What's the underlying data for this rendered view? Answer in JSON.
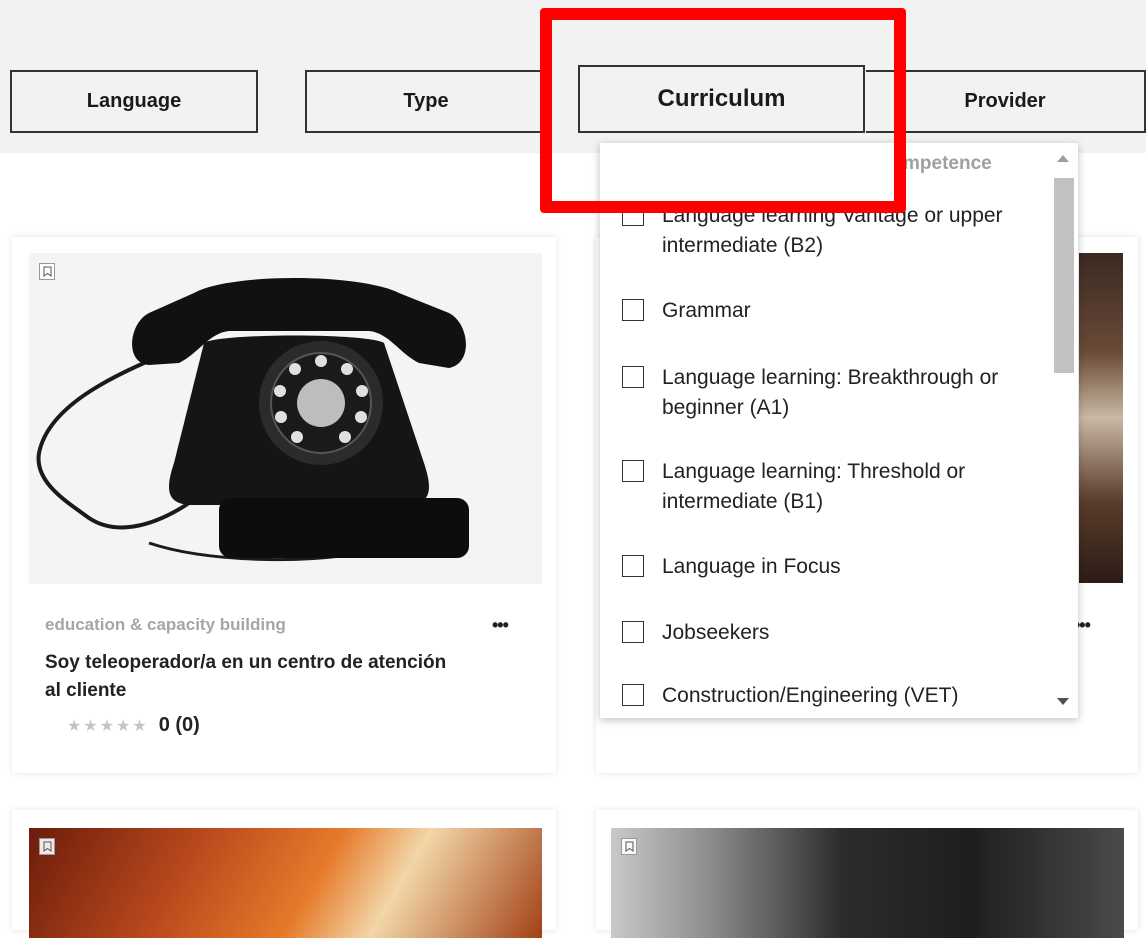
{
  "filters": {
    "language_label": "Language",
    "type_label": "Type",
    "curriculum_label": "Curriculum",
    "provider_label": "Provider"
  },
  "dropdown": {
    "header_partial": "mpetence",
    "options": [
      "Language learning Vantage or upper intermediate (B2)",
      "Grammar",
      "Language learning: Breakthrough or beginner (A1)",
      "Language learning: Threshold or intermediate (B1)",
      "Language in Focus",
      "Jobseekers",
      "Construction/Engineering (VET)"
    ]
  },
  "cards": [
    {
      "category": "education & capacity building",
      "title": "Soy teleoperador/a en un centro de atención al cliente",
      "rating_text": "0 (0)",
      "stars": "★★★★★",
      "more": "•••"
    },
    {
      "more": "•••"
    }
  ],
  "colors": {
    "highlight": "#ff0000",
    "filter_bar": "#f2f2f2"
  },
  "icons": {
    "bookmark": "bookmark-icon",
    "more": "more-options-icon"
  }
}
